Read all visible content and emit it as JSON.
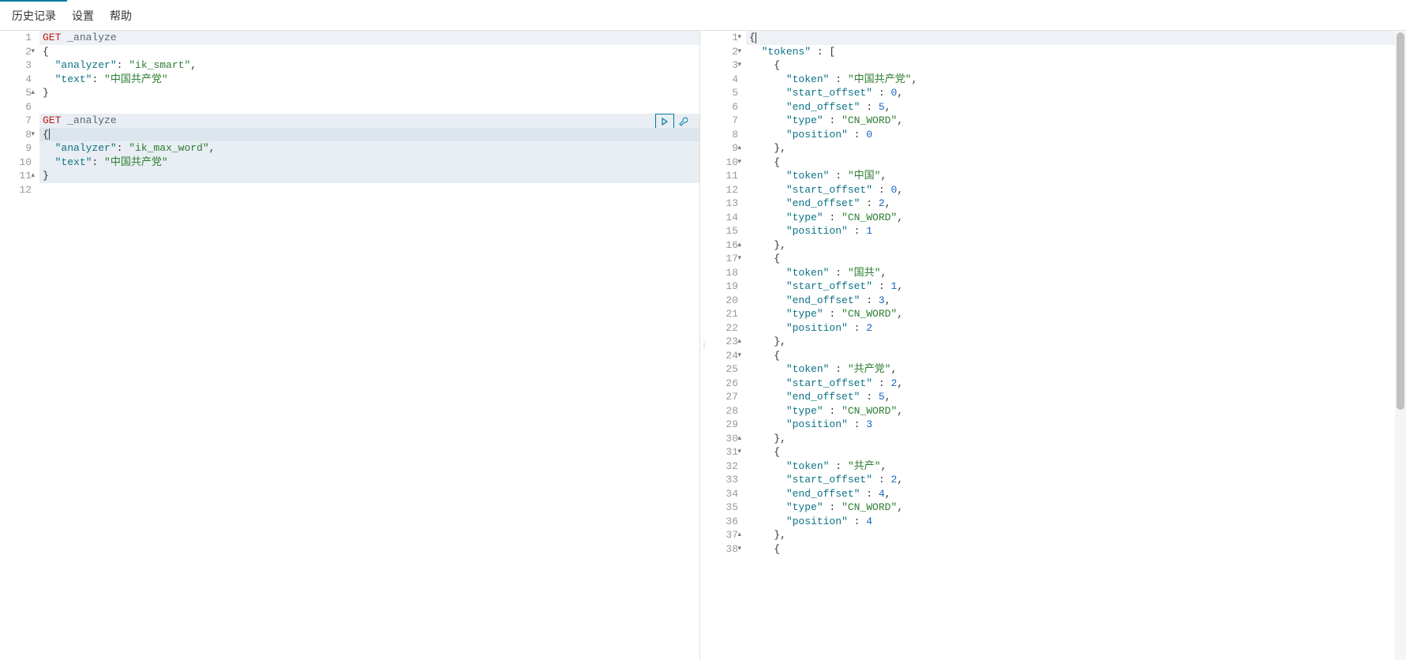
{
  "menu": {
    "history": "历史记录",
    "settings": "设置",
    "help": "帮助"
  },
  "request": {
    "lines": [
      {
        "n": 1,
        "fold": "",
        "hl": "first",
        "tokens": [
          {
            "t": "GET",
            "c": "method"
          },
          {
            "t": " ",
            "c": ""
          },
          {
            "t": "_analyze",
            "c": "path"
          }
        ]
      },
      {
        "n": 2,
        "fold": "▼",
        "hl": "",
        "tokens": [
          {
            "t": "{",
            "c": "punc"
          }
        ]
      },
      {
        "n": 3,
        "fold": "",
        "hl": "",
        "tokens": [
          {
            "t": "  ",
            "c": ""
          },
          {
            "t": "\"analyzer\"",
            "c": "key"
          },
          {
            "t": ": ",
            "c": "punc"
          },
          {
            "t": "\"ik_smart\"",
            "c": "str"
          },
          {
            "t": ",",
            "c": "punc"
          }
        ]
      },
      {
        "n": 4,
        "fold": "",
        "hl": "",
        "tokens": [
          {
            "t": "  ",
            "c": ""
          },
          {
            "t": "\"text\"",
            "c": "key"
          },
          {
            "t": ": ",
            "c": "punc"
          },
          {
            "t": "\"中国共产党\"",
            "c": "str"
          }
        ]
      },
      {
        "n": 5,
        "fold": "▲",
        "hl": "",
        "tokens": [
          {
            "t": "}",
            "c": "punc"
          }
        ]
      },
      {
        "n": 6,
        "fold": "",
        "hl": "",
        "tokens": []
      },
      {
        "n": 7,
        "fold": "",
        "hl": "block",
        "actions": true,
        "tokens": [
          {
            "t": "GET",
            "c": "method"
          },
          {
            "t": " ",
            "c": ""
          },
          {
            "t": "_analyze",
            "c": "path"
          }
        ]
      },
      {
        "n": 8,
        "fold": "▼",
        "hl": "line",
        "cursor": true,
        "tokens": [
          {
            "t": "{",
            "c": "punc"
          }
        ]
      },
      {
        "n": 9,
        "fold": "",
        "hl": "block",
        "tokens": [
          {
            "t": "  ",
            "c": ""
          },
          {
            "t": "\"analyzer\"",
            "c": "key"
          },
          {
            "t": ": ",
            "c": "punc"
          },
          {
            "t": "\"ik_max_word\"",
            "c": "str"
          },
          {
            "t": ",",
            "c": "punc"
          }
        ]
      },
      {
        "n": 10,
        "fold": "",
        "hl": "block",
        "tokens": [
          {
            "t": "  ",
            "c": ""
          },
          {
            "t": "\"text\"",
            "c": "key"
          },
          {
            "t": ": ",
            "c": "punc"
          },
          {
            "t": "\"中国共产党\"",
            "c": "str"
          }
        ]
      },
      {
        "n": 11,
        "fold": "▲",
        "hl": "block",
        "tokens": [
          {
            "t": "}",
            "c": "punc"
          }
        ]
      },
      {
        "n": 12,
        "fold": "",
        "hl": "",
        "tokens": []
      }
    ]
  },
  "response": {
    "lines": [
      {
        "n": 1,
        "fold": "▼",
        "hl": "first",
        "cursor": true,
        "tokens": [
          {
            "t": "{",
            "c": "punc"
          }
        ]
      },
      {
        "n": 2,
        "fold": "▼",
        "tokens": [
          {
            "t": "  ",
            "c": ""
          },
          {
            "t": "\"tokens\"",
            "c": "key"
          },
          {
            "t": " : [",
            "c": "punc"
          }
        ]
      },
      {
        "n": 3,
        "fold": "▼",
        "tokens": [
          {
            "t": "    {",
            "c": "punc"
          }
        ]
      },
      {
        "n": 4,
        "fold": "",
        "tokens": [
          {
            "t": "      ",
            "c": ""
          },
          {
            "t": "\"token\"",
            "c": "key"
          },
          {
            "t": " : ",
            "c": "punc"
          },
          {
            "t": "\"中国共产党\"",
            "c": "str"
          },
          {
            "t": ",",
            "c": "punc"
          }
        ]
      },
      {
        "n": 5,
        "fold": "",
        "tokens": [
          {
            "t": "      ",
            "c": ""
          },
          {
            "t": "\"start_offset\"",
            "c": "key"
          },
          {
            "t": " : ",
            "c": "punc"
          },
          {
            "t": "0",
            "c": "num"
          },
          {
            "t": ",",
            "c": "punc"
          }
        ]
      },
      {
        "n": 6,
        "fold": "",
        "tokens": [
          {
            "t": "      ",
            "c": ""
          },
          {
            "t": "\"end_offset\"",
            "c": "key"
          },
          {
            "t": " : ",
            "c": "punc"
          },
          {
            "t": "5",
            "c": "num"
          },
          {
            "t": ",",
            "c": "punc"
          }
        ]
      },
      {
        "n": 7,
        "fold": "",
        "tokens": [
          {
            "t": "      ",
            "c": ""
          },
          {
            "t": "\"type\"",
            "c": "key"
          },
          {
            "t": " : ",
            "c": "punc"
          },
          {
            "t": "\"CN_WORD\"",
            "c": "str"
          },
          {
            "t": ",",
            "c": "punc"
          }
        ]
      },
      {
        "n": 8,
        "fold": "",
        "tokens": [
          {
            "t": "      ",
            "c": ""
          },
          {
            "t": "\"position\"",
            "c": "key"
          },
          {
            "t": " : ",
            "c": "punc"
          },
          {
            "t": "0",
            "c": "num"
          }
        ]
      },
      {
        "n": 9,
        "fold": "▲",
        "tokens": [
          {
            "t": "    },",
            "c": "punc"
          }
        ]
      },
      {
        "n": 10,
        "fold": "▼",
        "tokens": [
          {
            "t": "    {",
            "c": "punc"
          }
        ]
      },
      {
        "n": 11,
        "fold": "",
        "tokens": [
          {
            "t": "      ",
            "c": ""
          },
          {
            "t": "\"token\"",
            "c": "key"
          },
          {
            "t": " : ",
            "c": "punc"
          },
          {
            "t": "\"中国\"",
            "c": "str"
          },
          {
            "t": ",",
            "c": "punc"
          }
        ]
      },
      {
        "n": 12,
        "fold": "",
        "tokens": [
          {
            "t": "      ",
            "c": ""
          },
          {
            "t": "\"start_offset\"",
            "c": "key"
          },
          {
            "t": " : ",
            "c": "punc"
          },
          {
            "t": "0",
            "c": "num"
          },
          {
            "t": ",",
            "c": "punc"
          }
        ]
      },
      {
        "n": 13,
        "fold": "",
        "tokens": [
          {
            "t": "      ",
            "c": ""
          },
          {
            "t": "\"end_offset\"",
            "c": "key"
          },
          {
            "t": " : ",
            "c": "punc"
          },
          {
            "t": "2",
            "c": "num"
          },
          {
            "t": ",",
            "c": "punc"
          }
        ]
      },
      {
        "n": 14,
        "fold": "",
        "tokens": [
          {
            "t": "      ",
            "c": ""
          },
          {
            "t": "\"type\"",
            "c": "key"
          },
          {
            "t": " : ",
            "c": "punc"
          },
          {
            "t": "\"CN_WORD\"",
            "c": "str"
          },
          {
            "t": ",",
            "c": "punc"
          }
        ]
      },
      {
        "n": 15,
        "fold": "",
        "tokens": [
          {
            "t": "      ",
            "c": ""
          },
          {
            "t": "\"position\"",
            "c": "key"
          },
          {
            "t": " : ",
            "c": "punc"
          },
          {
            "t": "1",
            "c": "num"
          }
        ]
      },
      {
        "n": 16,
        "fold": "▲",
        "tokens": [
          {
            "t": "    },",
            "c": "punc"
          }
        ]
      },
      {
        "n": 17,
        "fold": "▼",
        "tokens": [
          {
            "t": "    {",
            "c": "punc"
          }
        ]
      },
      {
        "n": 18,
        "fold": "",
        "tokens": [
          {
            "t": "      ",
            "c": ""
          },
          {
            "t": "\"token\"",
            "c": "key"
          },
          {
            "t": " : ",
            "c": "punc"
          },
          {
            "t": "\"国共\"",
            "c": "str"
          },
          {
            "t": ",",
            "c": "punc"
          }
        ]
      },
      {
        "n": 19,
        "fold": "",
        "tokens": [
          {
            "t": "      ",
            "c": ""
          },
          {
            "t": "\"start_offset\"",
            "c": "key"
          },
          {
            "t": " : ",
            "c": "punc"
          },
          {
            "t": "1",
            "c": "num"
          },
          {
            "t": ",",
            "c": "punc"
          }
        ]
      },
      {
        "n": 20,
        "fold": "",
        "tokens": [
          {
            "t": "      ",
            "c": ""
          },
          {
            "t": "\"end_offset\"",
            "c": "key"
          },
          {
            "t": " : ",
            "c": "punc"
          },
          {
            "t": "3",
            "c": "num"
          },
          {
            "t": ",",
            "c": "punc"
          }
        ]
      },
      {
        "n": 21,
        "fold": "",
        "tokens": [
          {
            "t": "      ",
            "c": ""
          },
          {
            "t": "\"type\"",
            "c": "key"
          },
          {
            "t": " : ",
            "c": "punc"
          },
          {
            "t": "\"CN_WORD\"",
            "c": "str"
          },
          {
            "t": ",",
            "c": "punc"
          }
        ]
      },
      {
        "n": 22,
        "fold": "",
        "tokens": [
          {
            "t": "      ",
            "c": ""
          },
          {
            "t": "\"position\"",
            "c": "key"
          },
          {
            "t": " : ",
            "c": "punc"
          },
          {
            "t": "2",
            "c": "num"
          }
        ]
      },
      {
        "n": 23,
        "fold": "▲",
        "tokens": [
          {
            "t": "    },",
            "c": "punc"
          }
        ]
      },
      {
        "n": 24,
        "fold": "▼",
        "tokens": [
          {
            "t": "    {",
            "c": "punc"
          }
        ]
      },
      {
        "n": 25,
        "fold": "",
        "tokens": [
          {
            "t": "      ",
            "c": ""
          },
          {
            "t": "\"token\"",
            "c": "key"
          },
          {
            "t": " : ",
            "c": "punc"
          },
          {
            "t": "\"共产党\"",
            "c": "str"
          },
          {
            "t": ",",
            "c": "punc"
          }
        ]
      },
      {
        "n": 26,
        "fold": "",
        "tokens": [
          {
            "t": "      ",
            "c": ""
          },
          {
            "t": "\"start_offset\"",
            "c": "key"
          },
          {
            "t": " : ",
            "c": "punc"
          },
          {
            "t": "2",
            "c": "num"
          },
          {
            "t": ",",
            "c": "punc"
          }
        ]
      },
      {
        "n": 27,
        "fold": "",
        "tokens": [
          {
            "t": "      ",
            "c": ""
          },
          {
            "t": "\"end_offset\"",
            "c": "key"
          },
          {
            "t": " : ",
            "c": "punc"
          },
          {
            "t": "5",
            "c": "num"
          },
          {
            "t": ",",
            "c": "punc"
          }
        ]
      },
      {
        "n": 28,
        "fold": "",
        "tokens": [
          {
            "t": "      ",
            "c": ""
          },
          {
            "t": "\"type\"",
            "c": "key"
          },
          {
            "t": " : ",
            "c": "punc"
          },
          {
            "t": "\"CN_WORD\"",
            "c": "str"
          },
          {
            "t": ",",
            "c": "punc"
          }
        ]
      },
      {
        "n": 29,
        "fold": "",
        "tokens": [
          {
            "t": "      ",
            "c": ""
          },
          {
            "t": "\"position\"",
            "c": "key"
          },
          {
            "t": " : ",
            "c": "punc"
          },
          {
            "t": "3",
            "c": "num"
          }
        ]
      },
      {
        "n": 30,
        "fold": "▲",
        "tokens": [
          {
            "t": "    },",
            "c": "punc"
          }
        ]
      },
      {
        "n": 31,
        "fold": "▼",
        "tokens": [
          {
            "t": "    {",
            "c": "punc"
          }
        ]
      },
      {
        "n": 32,
        "fold": "",
        "tokens": [
          {
            "t": "      ",
            "c": ""
          },
          {
            "t": "\"token\"",
            "c": "key"
          },
          {
            "t": " : ",
            "c": "punc"
          },
          {
            "t": "\"共产\"",
            "c": "str"
          },
          {
            "t": ",",
            "c": "punc"
          }
        ]
      },
      {
        "n": 33,
        "fold": "",
        "tokens": [
          {
            "t": "      ",
            "c": ""
          },
          {
            "t": "\"start_offset\"",
            "c": "key"
          },
          {
            "t": " : ",
            "c": "punc"
          },
          {
            "t": "2",
            "c": "num"
          },
          {
            "t": ",",
            "c": "punc"
          }
        ]
      },
      {
        "n": 34,
        "fold": "",
        "tokens": [
          {
            "t": "      ",
            "c": ""
          },
          {
            "t": "\"end_offset\"",
            "c": "key"
          },
          {
            "t": " : ",
            "c": "punc"
          },
          {
            "t": "4",
            "c": "num"
          },
          {
            "t": ",",
            "c": "punc"
          }
        ]
      },
      {
        "n": 35,
        "fold": "",
        "tokens": [
          {
            "t": "      ",
            "c": ""
          },
          {
            "t": "\"type\"",
            "c": "key"
          },
          {
            "t": " : ",
            "c": "punc"
          },
          {
            "t": "\"CN_WORD\"",
            "c": "str"
          },
          {
            "t": ",",
            "c": "punc"
          }
        ]
      },
      {
        "n": 36,
        "fold": "",
        "tokens": [
          {
            "t": "      ",
            "c": ""
          },
          {
            "t": "\"position\"",
            "c": "key"
          },
          {
            "t": " : ",
            "c": "punc"
          },
          {
            "t": "4",
            "c": "num"
          }
        ]
      },
      {
        "n": 37,
        "fold": "▲",
        "tokens": [
          {
            "t": "    },",
            "c": "punc"
          }
        ]
      },
      {
        "n": 38,
        "fold": "▼",
        "tokens": [
          {
            "t": "    {",
            "c": "punc"
          }
        ]
      }
    ]
  }
}
